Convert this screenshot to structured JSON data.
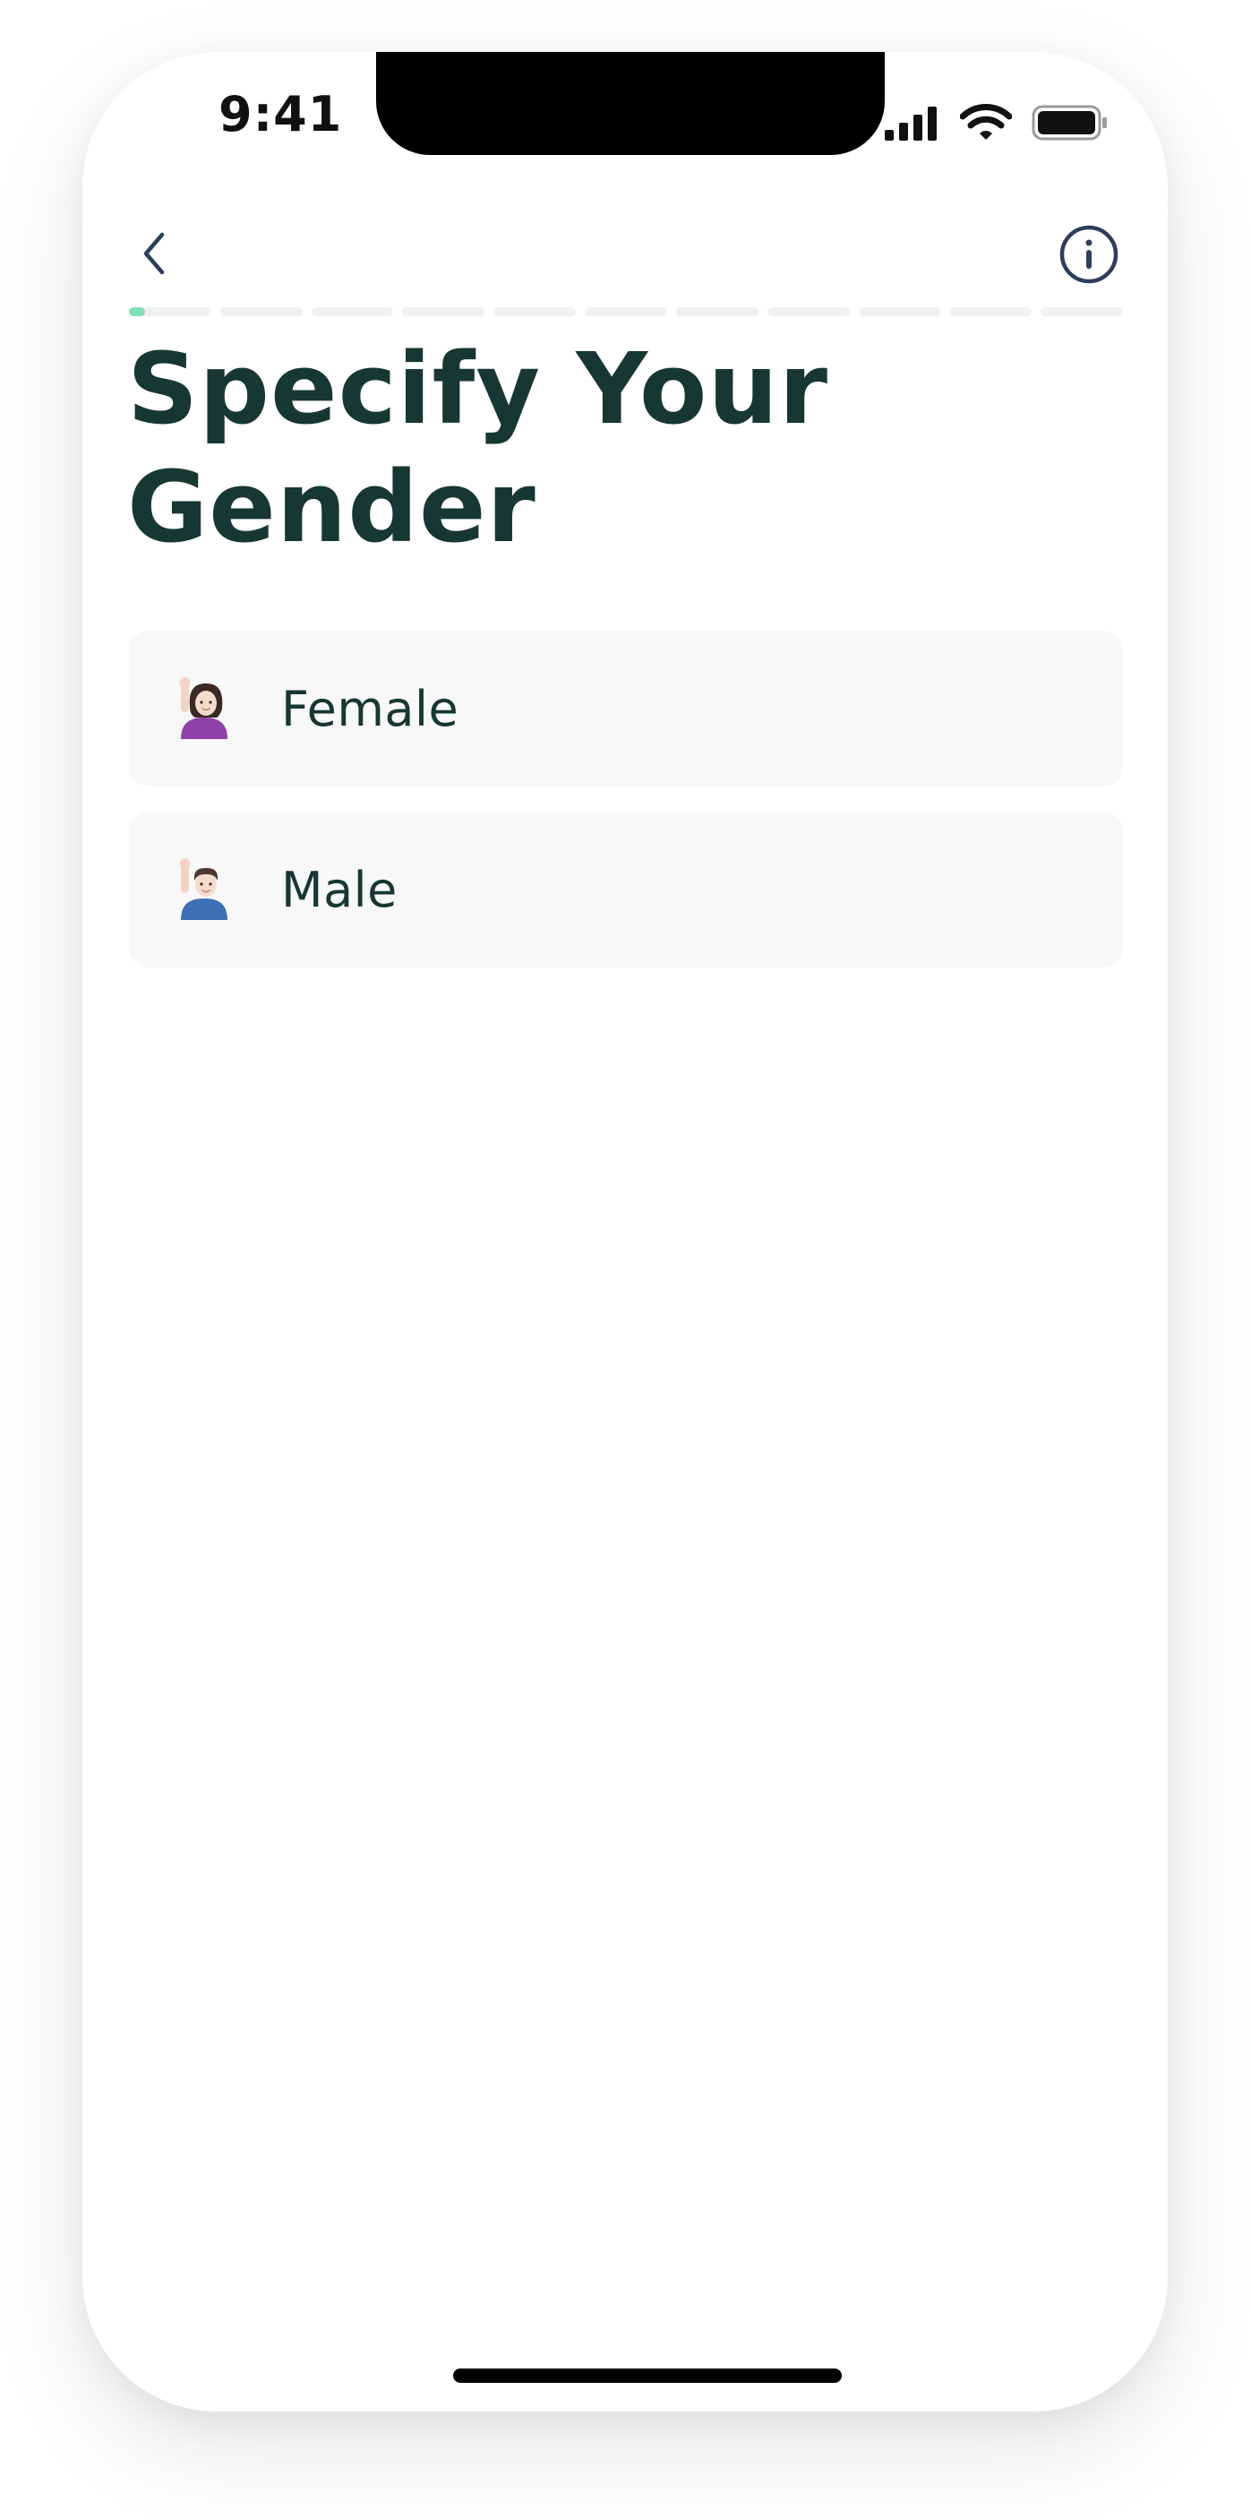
{
  "status_bar": {
    "time": "9:41",
    "icons": [
      "cellular-signal-icon",
      "wifi-icon",
      "battery-icon"
    ]
  },
  "header": {
    "back_icon": "chevron-left-icon",
    "info_icon": "info-icon",
    "progress": {
      "total_steps": 11,
      "current_step": 1,
      "current_step_fraction": 0.2
    }
  },
  "page": {
    "title_line1": "Specify Your",
    "title_line2": "Gender"
  },
  "options": [
    {
      "label": "Female",
      "icon": "woman-raising-hand-icon"
    },
    {
      "label": "Male",
      "icon": "man-raising-hand-icon"
    }
  ],
  "colors": {
    "title": "#173733",
    "accent": "#7fe0b4",
    "option_bg": "#f8f8f8",
    "icon_stroke": "#2c3e5c"
  }
}
